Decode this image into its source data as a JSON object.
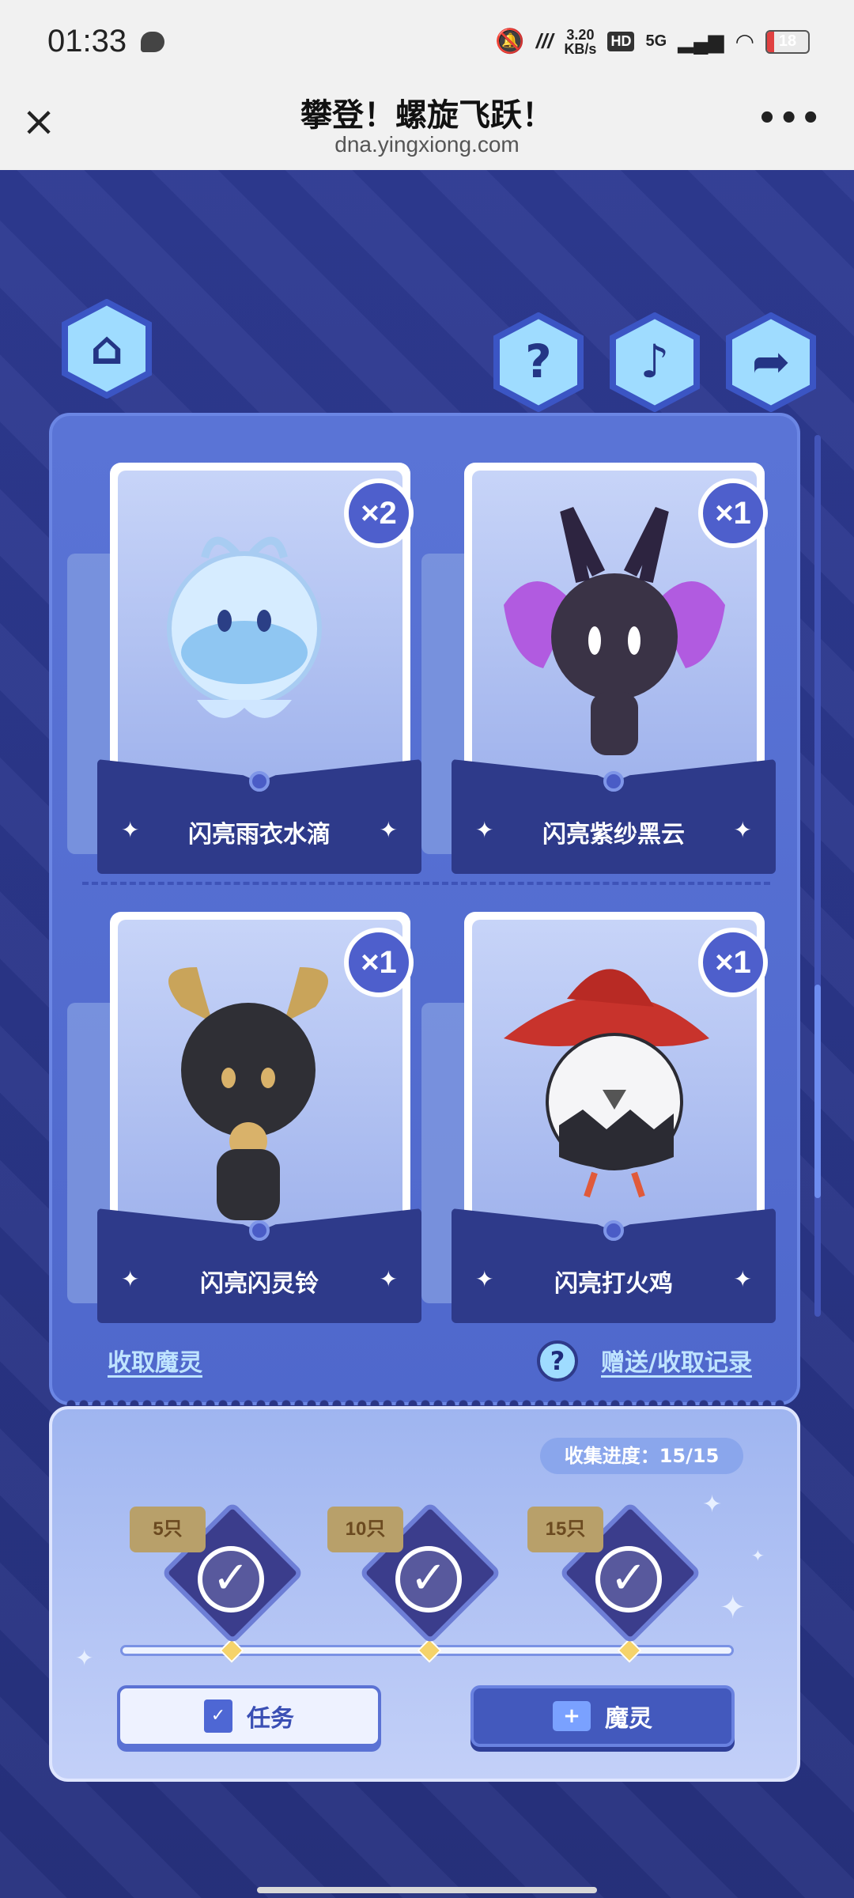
{
  "status_bar": {
    "time": "01:33",
    "net_speed_top": "3.20",
    "net_speed_bottom": "KB/s",
    "hd": "HD",
    "signal": "5G",
    "battery": "18",
    "battery_level": 0.18,
    "colors": {
      "battery": "#e04040"
    }
  },
  "title_bar": {
    "close_icon": "close-icon",
    "title": "攀登！螺旋飞跃！",
    "url": "dna.yingxiong.com",
    "more_icon": "more-icon"
  },
  "top_buttons": {
    "home": "home-icon",
    "help": "help-icon",
    "music": "music-icon",
    "share": "share-icon"
  },
  "cards": [
    {
      "name": "闪亮雨衣水滴",
      "count": "×2"
    },
    {
      "name": "闪亮紫纱黑云",
      "count": "×1"
    },
    {
      "name": "闪亮闪灵铃",
      "count": "×1"
    },
    {
      "name": "闪亮打火鸡",
      "count": "×1"
    }
  ],
  "panel_links": {
    "collect": "收取魔灵",
    "help_badge": "?",
    "records": "赠送/收取记录"
  },
  "collection": {
    "progress_label": "收集进度：",
    "progress_value": "15/15",
    "rewards": [
      {
        "tag": "5只",
        "claimed": true
      },
      {
        "tag": "10只",
        "claimed": true
      },
      {
        "tag": "15只",
        "claimed": true
      }
    ]
  },
  "buttons": {
    "task": "任务",
    "spirit": "魔灵"
  },
  "colors": {
    "background": "#2a3585",
    "panel": "#5a74d6",
    "accent": "#4e5fcc"
  }
}
